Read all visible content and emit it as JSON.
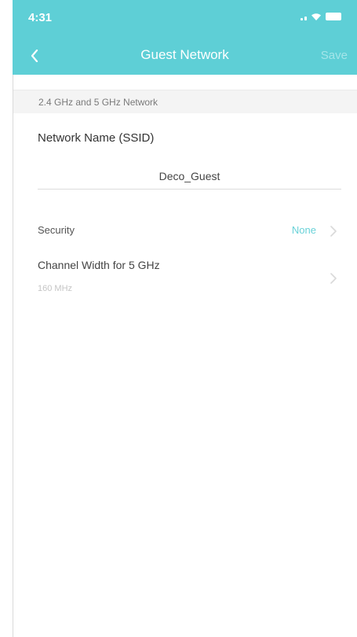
{
  "status_bar": {
    "time": "4:31"
  },
  "nav": {
    "title": "Guest Network",
    "save_label": "Save"
  },
  "section": {
    "header": "2.4 GHz and 5 GHz Network"
  },
  "ssid": {
    "label": "Network Name (SSID)",
    "value": "Deco_Guest"
  },
  "security": {
    "label": "Security",
    "value": "None"
  },
  "channel_width": {
    "label": "Channel Width for 5 GHz",
    "value": "160 MHz"
  },
  "colors": {
    "header_bg": "#5ecfd6",
    "accent": "#69d2d8"
  }
}
